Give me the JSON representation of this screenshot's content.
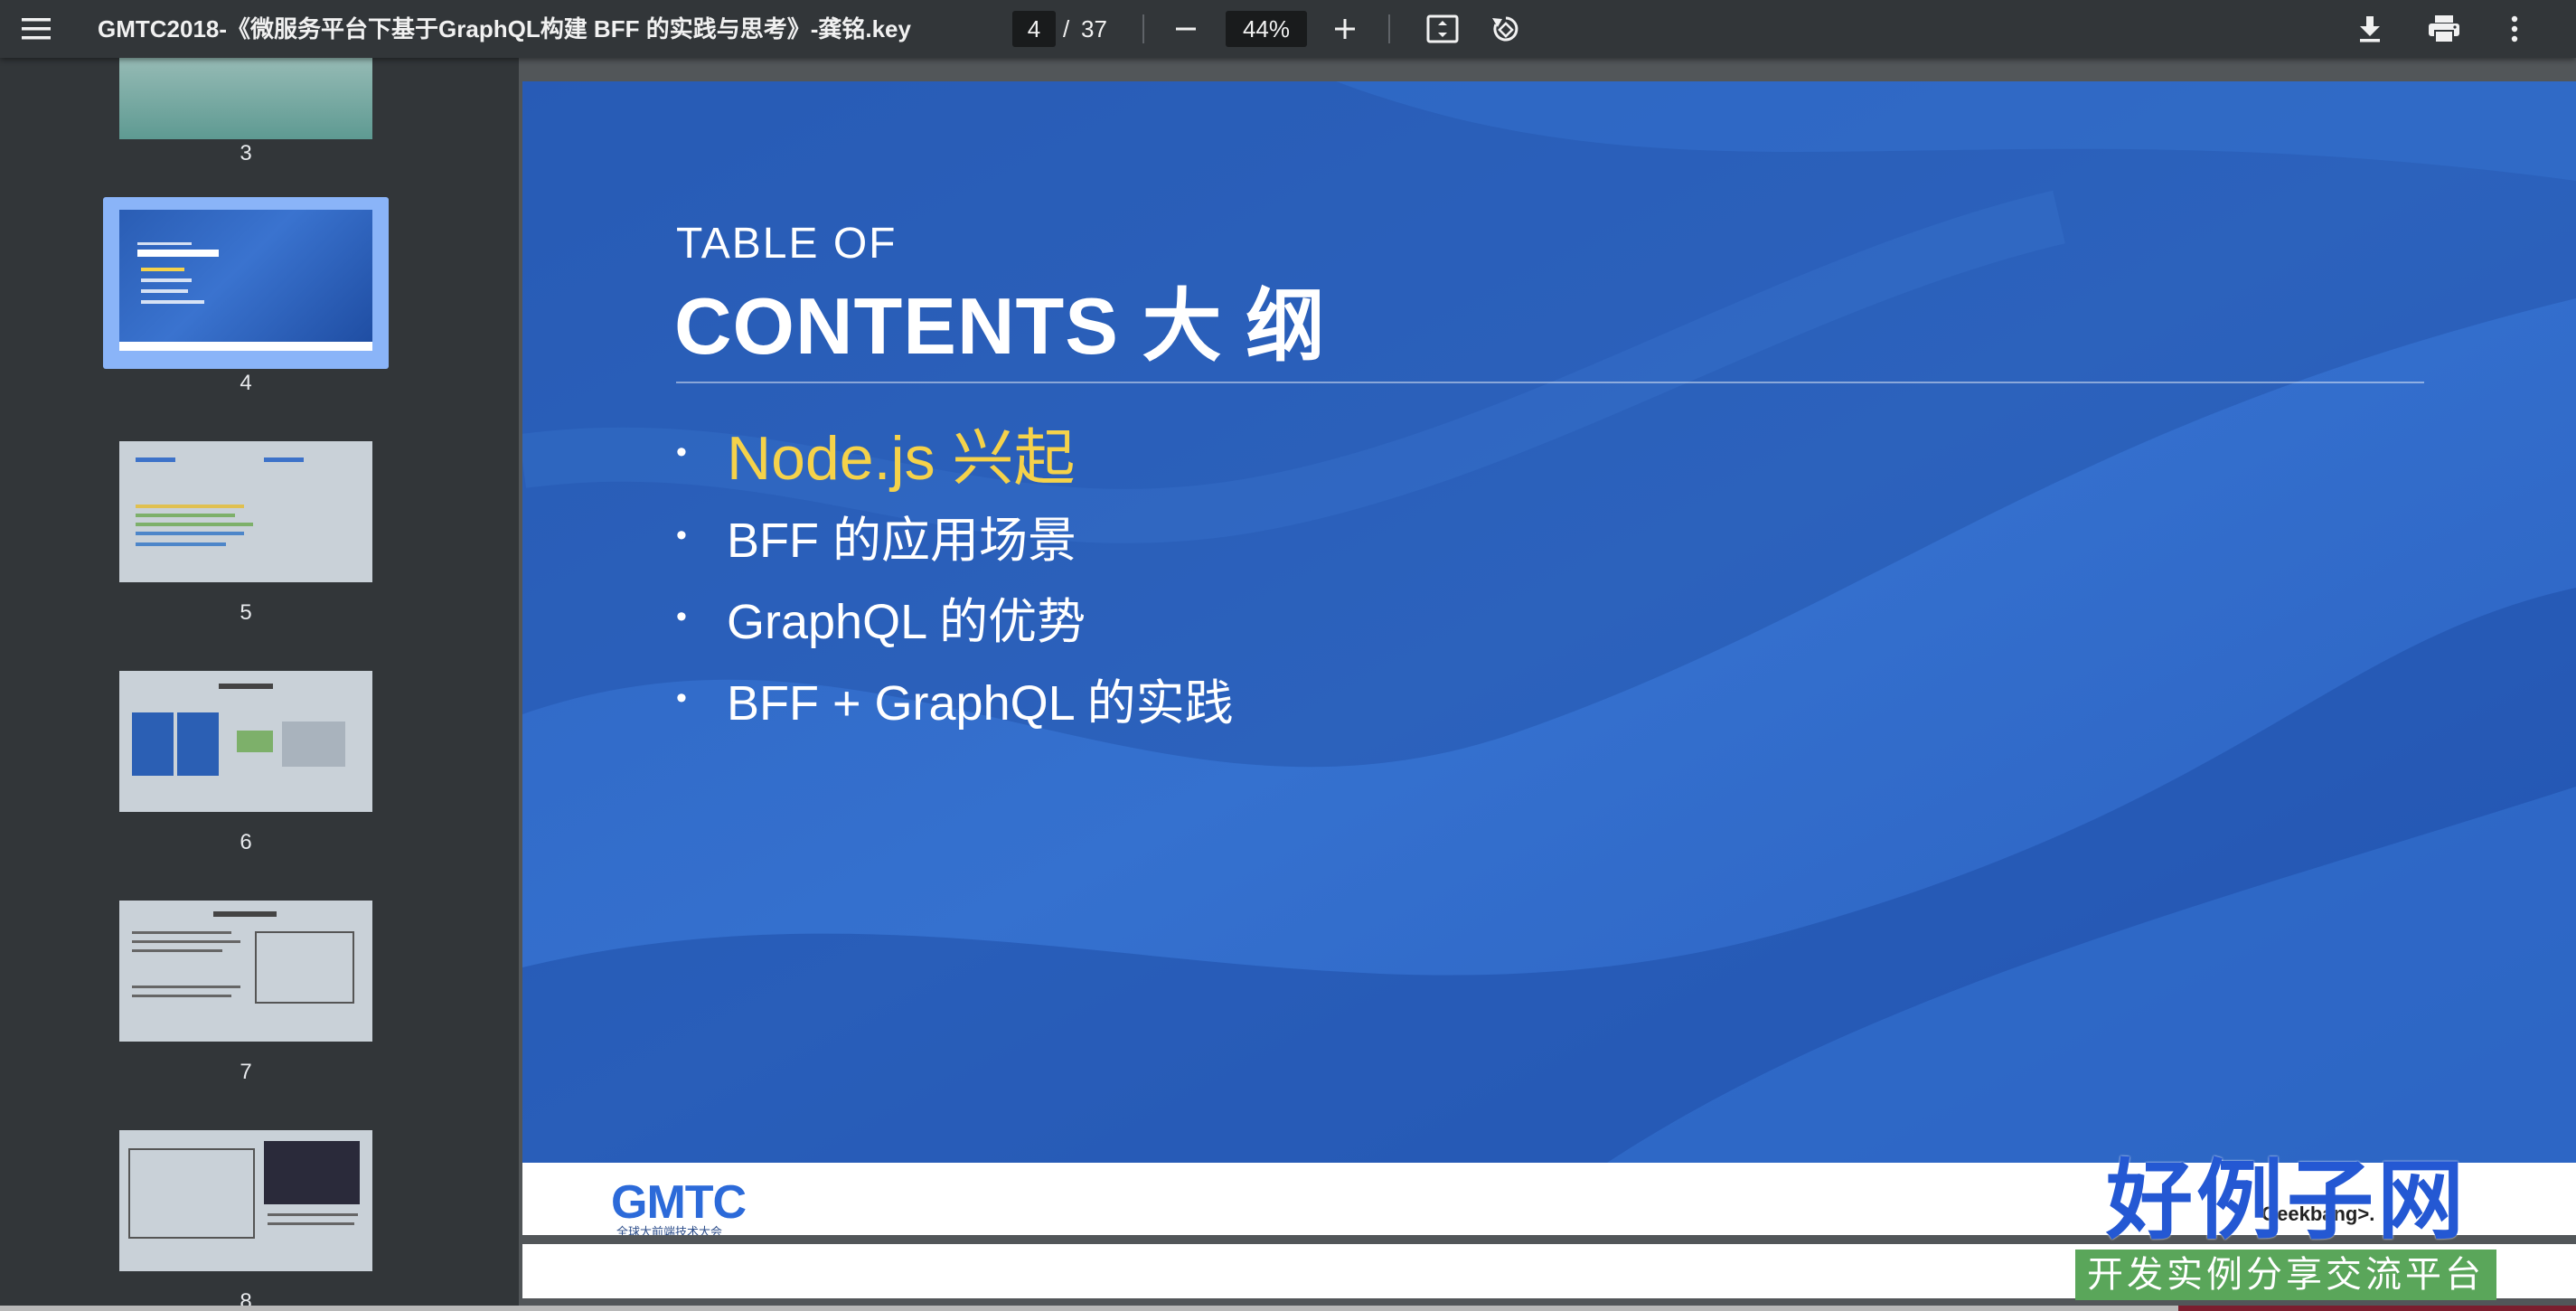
{
  "toolbar": {
    "title": "GMTC2018-《微服务平台下基于GraphQL构建 BFF 的实践与思考》-龚铭.key",
    "page_current": "4",
    "page_separator": "/",
    "page_total": "37",
    "zoom": "44%"
  },
  "icons": {
    "menu": "menu-icon",
    "zoom_out": "minus-icon",
    "zoom_in": "plus-icon",
    "fit": "fit-to-page-icon",
    "rotate": "rotate-icon",
    "download": "download-icon",
    "print": "print-icon",
    "more": "more-vert-icon"
  },
  "sidebar": {
    "selected_page": "4",
    "thumbnails": [
      {
        "number": "3"
      },
      {
        "number": "4"
      },
      {
        "number": "5"
      },
      {
        "number": "6"
      },
      {
        "number": "7"
      },
      {
        "number": "8"
      }
    ]
  },
  "slide": {
    "title_line1": "TABLE OF",
    "title_line2": "CONTENTS 大 纲",
    "items": [
      {
        "bullet": "•",
        "text": "Node.js 兴起",
        "active": true
      },
      {
        "bullet": "•",
        "text": "BFF 的应用场景",
        "active": false
      },
      {
        "bullet": "•",
        "text": "GraphQL 的优势",
        "active": false
      },
      {
        "bullet": "•",
        "text": "BFF + GraphQL 的实践",
        "active": false
      }
    ],
    "footer_logo": "GMTC",
    "footer_logo_sub": "全球大前端技术大会",
    "footer_right": "Geekbang>."
  },
  "watermark": {
    "brand": "好例子网",
    "tagline": "开发实例分享交流平台"
  },
  "colors": {
    "toolbar_bg": "#323639",
    "viewer_bg": "#525659",
    "slide_blue": "#2f66c0",
    "active_item": "#f5d24a",
    "selection": "#8ab4f8"
  }
}
